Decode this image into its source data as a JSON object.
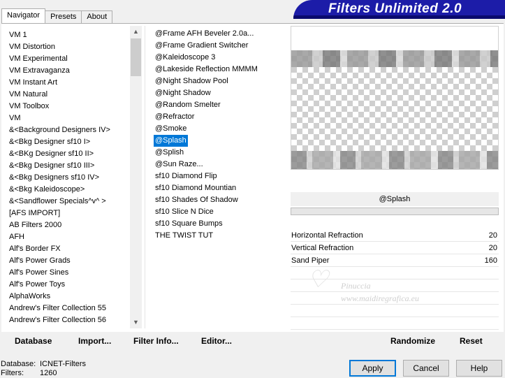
{
  "tabs": [
    "Navigator",
    "Presets",
    "About"
  ],
  "banner_title": "Filters Unlimited 2.0",
  "categories": [
    "VM 1",
    "VM Distortion",
    "VM Experimental",
    "VM Extravaganza",
    "VM Instant Art",
    "VM Natural",
    "VM Toolbox",
    "VM",
    "&<Background Designers IV>",
    "&<Bkg Designer sf10 I>",
    "&<BKg Designer sf10 II>",
    "&<Bkg Designer sf10 III>",
    "&<Bkg Designers sf10 IV>",
    "&<Bkg Kaleidoscope>",
    "&<Sandflower Specials^v^ >",
    "[AFS IMPORT]",
    "AB Filters 2000",
    "AFH",
    "Alf's Border FX",
    "Alf's Power Grads",
    "Alf's Power Sines",
    "Alf's Power Toys",
    "AlphaWorks",
    "Andrew's Filter Collection 55",
    "Andrew's Filter Collection 56"
  ],
  "selected_category": "&<Background Designers IV>",
  "filters": [
    "@Frame AFH Beveler 2.0a...",
    "@Frame Gradient Switcher",
    "@Kaleidoscope 3",
    "@Lakeside Reflection MMMM",
    "@Night Shadow Pool",
    "@Night Shadow",
    "@Random Smelter",
    "@Refractor",
    "@Smoke",
    "@Splash",
    "@Splish",
    "@Sun Raze...",
    "sf10 Diamond Flip",
    "sf10 Diamond Mountian",
    "sf10 Shades Of Shadow",
    "sf10 Slice N Dice",
    "sf10 Square Bumps",
    "THE TWIST TUT"
  ],
  "selected_filter": "@Splash",
  "params": [
    {
      "name": "Horizontal Refraction",
      "value": "20"
    },
    {
      "name": "Vertical Refraction",
      "value": "20"
    },
    {
      "name": "Sand Piper",
      "value": "160"
    }
  ],
  "watermark": {
    "name": "Pinuccia",
    "url": "www.maidiregrafica.eu"
  },
  "left_buttons": {
    "database": "Database",
    "import": "Import...",
    "filter_info": "Filter Info...",
    "editor": "Editor..."
  },
  "right_buttons": {
    "randomize": "Randomize",
    "reset": "Reset"
  },
  "status": {
    "database_label": "Database:",
    "database_value": "ICNET-Filters",
    "filters_label": "Filters:",
    "filters_value": "1260"
  },
  "dialog": {
    "apply": "Apply",
    "cancel": "Cancel",
    "help": "Help"
  },
  "colors": {
    "banner": "#1c1ca8",
    "selection": "#0078d7"
  }
}
